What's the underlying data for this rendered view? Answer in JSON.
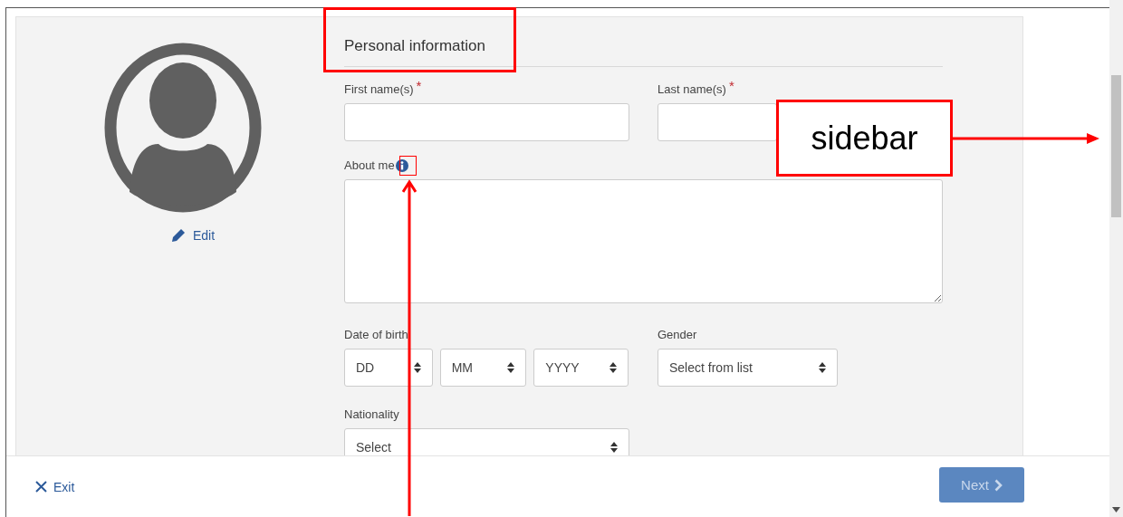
{
  "heading": "Personal information",
  "avatar": {
    "edit_label": "Edit"
  },
  "rows": [
    {
      "fields": [
        {
          "kind": "text",
          "label": "First name(s)",
          "marker": "*"
        },
        {
          "kind": "text",
          "label": "Last name(s)",
          "marker": "*"
        }
      ]
    },
    {
      "fields": [
        {
          "kind": "textarea",
          "label": "About me",
          "info": true
        }
      ]
    },
    {
      "fields": [
        {
          "kind": "date",
          "label": "Date of birth",
          "parts": [
            "DD",
            "MM",
            "YYYY"
          ]
        },
        {
          "kind": "select",
          "label": "Gender",
          "value": "Select from list"
        }
      ]
    },
    {
      "fields": [
        {
          "kind": "select",
          "label": "Nationality",
          "value": "Select"
        }
      ]
    }
  ],
  "footer": {
    "exit_label": "Exit",
    "next_label": "Next",
    "next_disabled": true
  },
  "callout": {
    "text": "sidebar"
  }
}
